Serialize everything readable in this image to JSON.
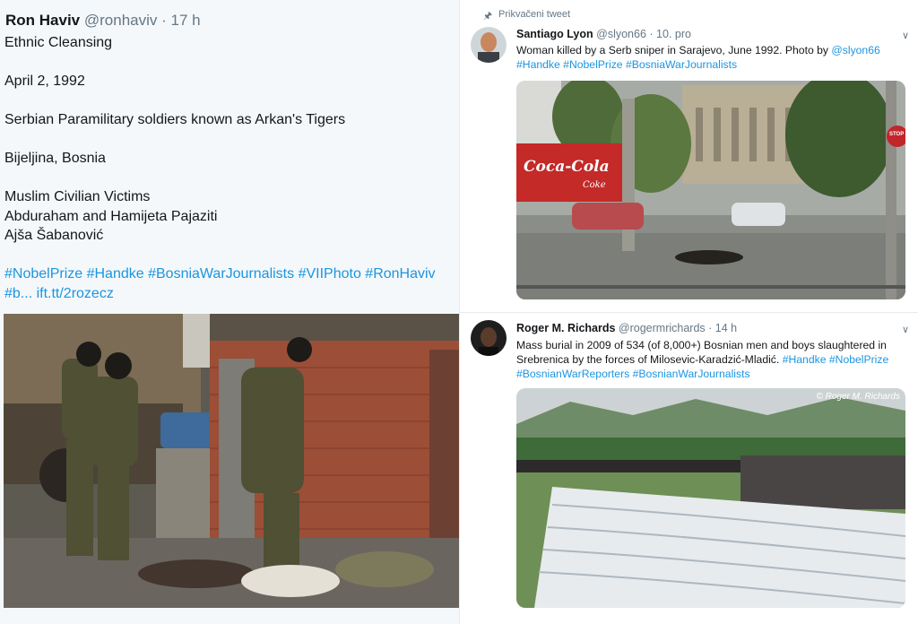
{
  "left_tweet": {
    "name": "Ron Haviv",
    "handle": "@ronhaviv",
    "separator": "·",
    "time": "17 h",
    "paragraphs": [
      "Ethnic Cleansing",
      "April 2, 1992",
      "Serbian Paramilitary soldiers known as Arkan's Tigers",
      "Bijeljina, Bosnia"
    ],
    "victims": [
      "Muslim Civilian Victims",
      "Abduraham and Hamijeta Pajaziti",
      "Ajša Šabanović"
    ],
    "tags_line1": "#NobelPrize #Handke #BosniaWarJournalists #VIIPhoto #RonHaviv",
    "tags_line2": "#b... ift.tt/2rozecz"
  },
  "pinned_label": "Prikvačeni tweet",
  "tweets": [
    {
      "name": "Santiago Lyon",
      "handle": "@slyon66",
      "time": "· 10. pro",
      "text": "Woman killed by a Serb sniper in Sarajevo, June 1992. Photo by",
      "text_link": "@slyon66",
      "tags": "#Handke  #NobelPrize #BosniaWarJournalists",
      "photo_sign": "Coca-Cola",
      "photo_sign_sub": "Coke",
      "photo_stop": "STOP"
    },
    {
      "name": "Roger M. Richards",
      "handle": "@rogermrichards",
      "time": "· 14 h",
      "text": "Mass burial in 2009 of 534 (of 8,000+) Bosnian men and boys slaughtered in Srebrenica by the forces of Milosevic-Karadzić-Mladić.",
      "tags_inline": "#Handke #NobelPrize",
      "tags_line": "#BosnianWarReporters #BosnianWarJournalists",
      "credit": "© Roger M. Richards"
    }
  ],
  "icons": {
    "pin": "pin-icon",
    "caret": "chevron-down-icon"
  },
  "colors": {
    "link": "#1b95e0",
    "secondary_text": "#657786",
    "left_background": "#f5f8fa"
  }
}
